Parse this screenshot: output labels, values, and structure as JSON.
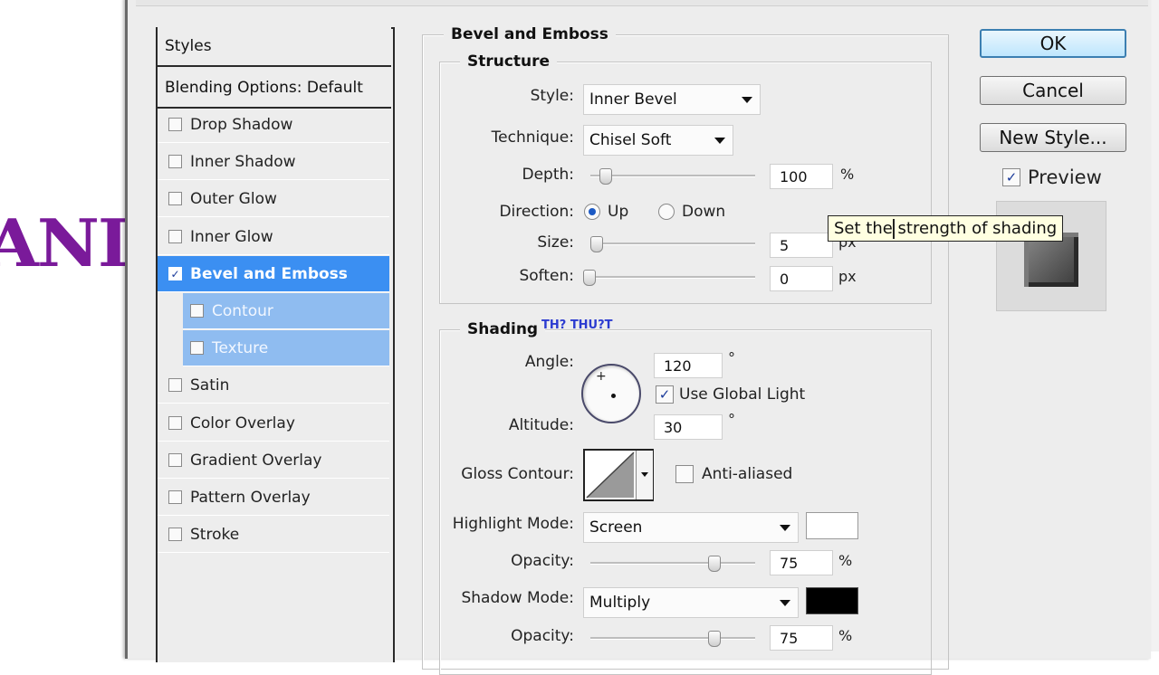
{
  "background_fragment": "ANI",
  "styles_panel": {
    "header": "Styles",
    "blending": "Blending Options: Default",
    "items": [
      {
        "label": "Drop Shadow",
        "checked": false
      },
      {
        "label": "Inner Shadow",
        "checked": false
      },
      {
        "label": "Outer Glow",
        "checked": false
      },
      {
        "label": "Inner Glow",
        "checked": false
      },
      {
        "label": "Bevel and Emboss",
        "checked": true,
        "selected": true
      },
      {
        "label": "Contour",
        "checked": false,
        "sub": true
      },
      {
        "label": "Texture",
        "checked": false,
        "sub": true
      },
      {
        "label": "Satin",
        "checked": false
      },
      {
        "label": "Color Overlay",
        "checked": false
      },
      {
        "label": "Gradient Overlay",
        "checked": false
      },
      {
        "label": "Pattern Overlay",
        "checked": false
      },
      {
        "label": "Stroke",
        "checked": false
      }
    ]
  },
  "bevel": {
    "title": "Bevel and Emboss",
    "structure": {
      "title": "Structure",
      "style_label": "Style:",
      "style_value": "Inner Bevel",
      "technique_label": "Technique:",
      "technique_value": "Chisel Soft",
      "depth_label": "Depth:",
      "depth_value": "100",
      "depth_unit": "%",
      "direction_label": "Direction:",
      "dir_up": "Up",
      "dir_down": "Down",
      "direction_selected": "Up",
      "size_label": "Size:",
      "size_value": "5",
      "size_unit": "px",
      "soften_label": "Soften:",
      "soften_value": "0",
      "soften_unit": "px"
    },
    "shading": {
      "title": "Shading",
      "annotation": "TH? THU?T",
      "angle_label": "Angle:",
      "angle_value": "120",
      "degree": "°",
      "use_global_light": "Use Global Light",
      "use_global_light_checked": true,
      "altitude_label": "Altitude:",
      "altitude_value": "30",
      "gloss_label": "Gloss Contour:",
      "anti_aliased": "Anti-aliased",
      "anti_aliased_checked": false,
      "highlight_label": "Highlight Mode:",
      "highlight_value": "Screen",
      "highlight_color": "#ffffff",
      "opacity_label": "Opacity:",
      "highlight_opacity": "75",
      "opacity_unit": "%",
      "shadow_label": "Shadow Mode:",
      "shadow_value": "Multiply",
      "shadow_color": "#000000",
      "shadow_opacity": "75"
    }
  },
  "buttons": {
    "ok": "OK",
    "cancel": "Cancel",
    "new_style": "New Style..."
  },
  "preview_label": "Preview",
  "preview_checked": true,
  "tooltip": "Set the strength of shading",
  "colors": {
    "accent": "#3b8ff2",
    "sub_selected": "#8fbcf0",
    "text_purple": "#7a1a9a"
  }
}
